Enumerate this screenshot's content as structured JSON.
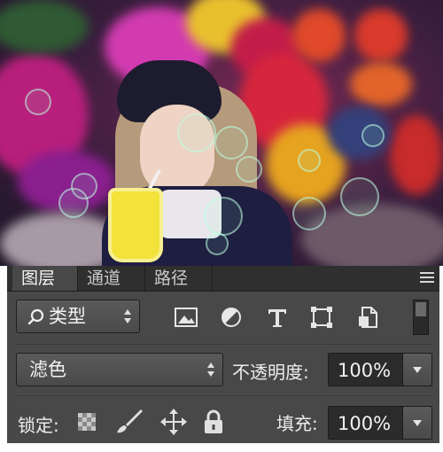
{
  "tabs": [
    {
      "label": "图层",
      "active": true
    },
    {
      "label": "通道",
      "active": false
    },
    {
      "label": "路径",
      "active": false
    }
  ],
  "filter": {
    "icon": "search-icon",
    "label": "类型"
  },
  "filter_icons": [
    "image-icon",
    "adjustment-circle-icon",
    "text-icon",
    "shape-icon",
    "smart-object-icon"
  ],
  "blend_mode": {
    "value": "滤色"
  },
  "opacity": {
    "label": "不透明度:",
    "value": "100%"
  },
  "lock": {
    "label": "锁定:",
    "icons": [
      "lock-transparent-icon",
      "lock-paint-brush-icon",
      "lock-move-icon",
      "lock-all-icon"
    ]
  },
  "fill": {
    "label": "填充:",
    "value": "100%"
  },
  "colors": {
    "panel_bg": "#484848",
    "tab_bar": "#2f2f2f",
    "text": "#e6e6e6"
  }
}
